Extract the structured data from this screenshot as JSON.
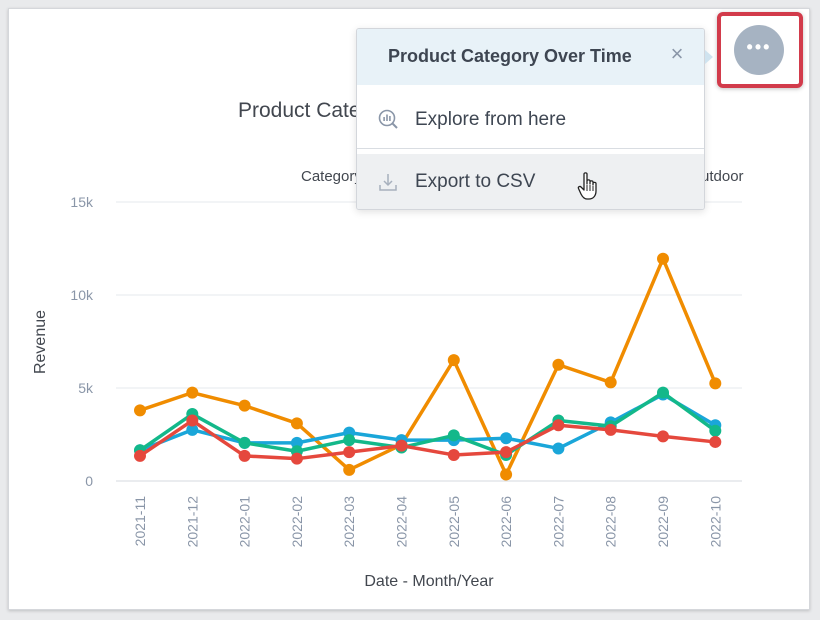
{
  "widget": {
    "title": "Product Category Over Time",
    "legend_label": "Category",
    "legend_last_partial": "utdoor"
  },
  "menu": {
    "title": "Product Category Over Time",
    "close_icon": "close-icon",
    "items": [
      {
        "label": "Explore from here",
        "icon": "explore-icon"
      },
      {
        "label": "Export to CSV",
        "icon": "download-icon"
      }
    ]
  },
  "options_button": {
    "icon": "more-horizontal-icon"
  },
  "colors": {
    "highlight": "#d23b4b",
    "menu_header_bg": "#e8f2f8",
    "series": [
      "#f08c00",
      "#13b88a",
      "#1aa6d9",
      "#e5483d"
    ]
  },
  "chart_data": {
    "type": "line",
    "x": [
      "2021-11",
      "2021-12",
      "2022-01",
      "2022-02",
      "2022-03",
      "2022-04",
      "2022-05",
      "2022-06",
      "2022-07",
      "2022-08",
      "2022-09",
      "2022-10"
    ],
    "xlabel": "Date - Month/Year",
    "ylabel": "Revenue",
    "ylim": [
      0,
      15000
    ],
    "yticks": [
      0,
      5000,
      10000,
      15000
    ],
    "ytick_labels": [
      "0",
      "5k",
      "10k",
      "15k"
    ],
    "grid": true,
    "series": [
      {
        "color": "#f08c00",
        "values": [
          3800,
          4750,
          4050,
          3100,
          600,
          1950,
          6500,
          350,
          6250,
          5300,
          11950,
          5250
        ]
      },
      {
        "color": "#1aa6d9",
        "values": [
          1650,
          2750,
          2050,
          2050,
          2600,
          2200,
          2200,
          2300,
          1750,
          3150,
          4650,
          3000
        ]
      },
      {
        "color": "#13b88a",
        "values": [
          1650,
          3600,
          2050,
          1600,
          2200,
          1800,
          2450,
          1400,
          3250,
          2950,
          4750,
          2700
        ]
      },
      {
        "color": "#e5483d",
        "values": [
          1350,
          3250,
          1350,
          1200,
          1550,
          1900,
          1400,
          1550,
          3000,
          2750,
          2400,
          2100
        ]
      }
    ]
  }
}
